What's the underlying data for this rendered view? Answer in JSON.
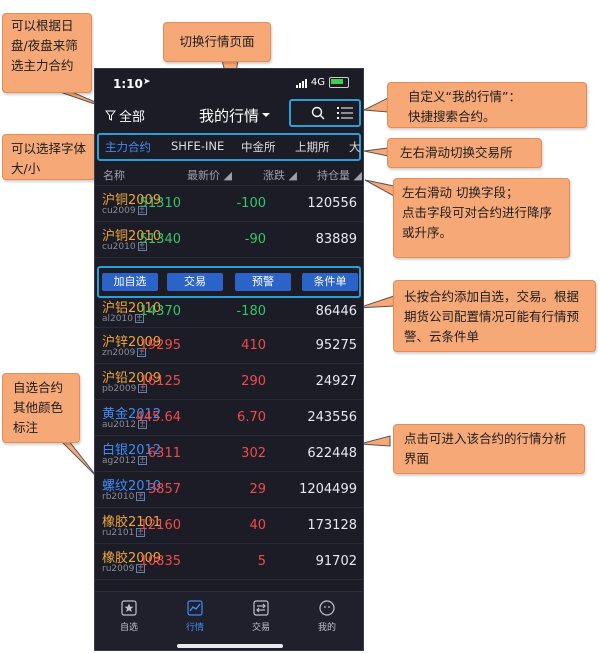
{
  "annotations": {
    "filter_note": "可以根据日盘/夜盘来筛选主力合约",
    "switch_page": "切换行情页面",
    "custom_search": "自定义“我的行情”：\n快捷搜索合约。",
    "font_size": "可以选择字体大/小",
    "swipe_exchange": "左右滑动切换交易所",
    "swipe_fields": "左右滑动  切换字段；\n点击字段可对合约进行降序或升序。",
    "long_press": "长按合约添加自选，交易。根据期货公司配置情况可能有行情预警、云条件单",
    "watchlist_color": "自选合约其他颜色标注",
    "tap_analysis": "点击可进入该合约的行情分析界面"
  },
  "status_bar": {
    "time": "1:10",
    "network": "4G"
  },
  "nav": {
    "all_label": "全部",
    "title": "我的行情",
    "search_icon": "search-icon",
    "menu_icon": "list-menu-icon"
  },
  "exchange_tabs": [
    "主力合约",
    "SHFE-INE",
    "中金所",
    "上期所",
    "大"
  ],
  "columns": {
    "name": "名称",
    "price": "最新价",
    "change": "涨跌",
    "hold": "持仓量"
  },
  "action_buttons": [
    "加自选",
    "交易",
    "预警",
    "条件单"
  ],
  "rows": [
    {
      "name": "沪铜2009",
      "code": "cu2009",
      "price": "51310",
      "change": "-100",
      "hold": "120556"
    },
    {
      "name": "沪铜2010",
      "code": "cu2010",
      "price": "51340",
      "change": "-90",
      "hold": "83889"
    },
    {
      "name": "沪铝2010",
      "code": "al2010",
      "price": "14370",
      "change": "-180",
      "hold": "86446"
    },
    {
      "name": "沪锌2009",
      "code": "zn2009",
      "price": "19295",
      "change": "410",
      "hold": "95275"
    },
    {
      "name": "沪铅2009",
      "code": "pb2009",
      "price": "16125",
      "change": "290",
      "hold": "24927"
    },
    {
      "name": "黄金2012",
      "code": "au2012",
      "price": "445.64",
      "change": "6.70",
      "hold": "243556"
    },
    {
      "name": "白银2012",
      "code": "ag2012",
      "price": "6311",
      "change": "302",
      "hold": "622448"
    },
    {
      "name": "螺纹2010",
      "code": "rb2010",
      "price": "3857",
      "change": "29",
      "hold": "1204499"
    },
    {
      "name": "橡胶2101",
      "code": "ru2101",
      "price": "12160",
      "change": "40",
      "hold": "173128"
    },
    {
      "name": "橡胶2009",
      "code": "ru2009",
      "price": "10835",
      "change": "5",
      "hold": "91702"
    }
  ],
  "tabbar": [
    "自选",
    "行情",
    "交易",
    "我的"
  ],
  "colors": {
    "up": "#f04b4b",
    "down": "#2fc56b",
    "highlight": "#2a9fd8",
    "callout": "#f6a877",
    "accent": "#3f8cf5"
  }
}
